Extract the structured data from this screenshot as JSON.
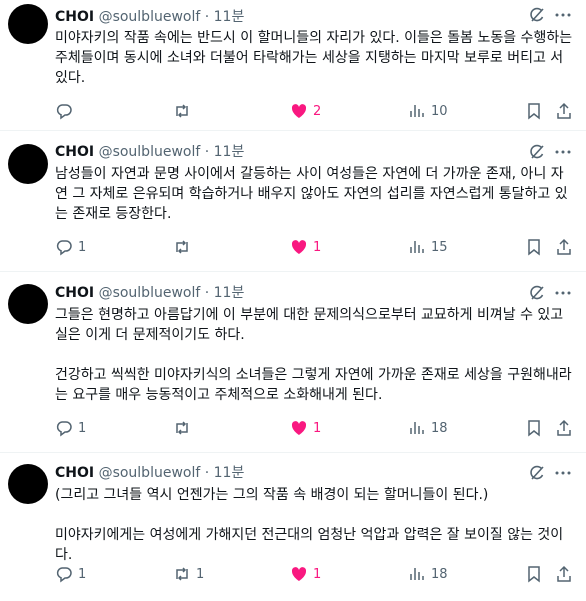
{
  "tweets": [
    {
      "name": "CHOI",
      "handle": "@soulbluewolf",
      "separator": "·",
      "time": "11분",
      "paragraphs": [
        "미야자키의 작품 속에는 반드시 이 할머니들의 자리가 있다. 이들은 돌봄 노동을 수행하는 주체들이며 동시에 소녀와 더불어 타락해가는 세상을 지탱하는 마지막 보루로 버티고 서 있다."
      ],
      "replies": "",
      "retweets": "",
      "likes": "2",
      "views": "10",
      "liked": true
    },
    {
      "name": "CHOI",
      "handle": "@soulbluewolf",
      "separator": "·",
      "time": "11분",
      "paragraphs": [
        "남성들이 자연과 문명 사이에서 갈등하는 사이 여성들은 자연에 더 가까운 존재, 아니 자연 그 자체로 은유되며 학습하거나 배우지 않아도 자연의 섭리를 자연스럽게 통달하고 있는 존재로 등장한다."
      ],
      "replies": "1",
      "retweets": "",
      "likes": "1",
      "views": "15",
      "liked": true
    },
    {
      "name": "CHOI",
      "handle": "@soulbluewolf",
      "separator": "·",
      "time": "11분",
      "paragraphs": [
        "그들은 현명하고 아름답기에 이 부분에 대한 문제의식으로부터 교묘하게 비껴날 수 있고 실은 이게 더 문제적이기도 하다.",
        "건강하고 씩씩한 미야자키식의 소녀들은 그렇게 자연에 가까운 존재로 세상을 구원해내라는 요구를 매우 능동적이고 주체적으로 소화해내게 된다."
      ],
      "replies": "1",
      "retweets": "",
      "likes": "1",
      "views": "18",
      "liked": true
    },
    {
      "name": "CHOI",
      "handle": "@soulbluewolf",
      "separator": "·",
      "time": "11분",
      "paragraphs": [
        "(그리고 그녀들 역시 언젠가는 그의 작품 속 배경이 되는 할머니들이 된다.)",
        "미야자키에게는 여성에게 가해지던 전근대의 엄청난 억압과 압력은 잘 보이질 않는 것이다."
      ],
      "replies": "1",
      "retweets": "1",
      "likes": "1",
      "views": "18",
      "liked": true
    }
  ],
  "icons": {
    "reply": "reply-icon",
    "retweet": "retweet-icon",
    "like": "heart-icon",
    "views": "views-icon",
    "bookmark": "bookmark-icon",
    "share": "share-icon",
    "grok": "grok-icon",
    "more": "more-icon"
  },
  "colors": {
    "like_active": "#f91880",
    "secondary_text": "#536471",
    "primary_text": "#0f1419",
    "divider": "#eff3f4"
  }
}
